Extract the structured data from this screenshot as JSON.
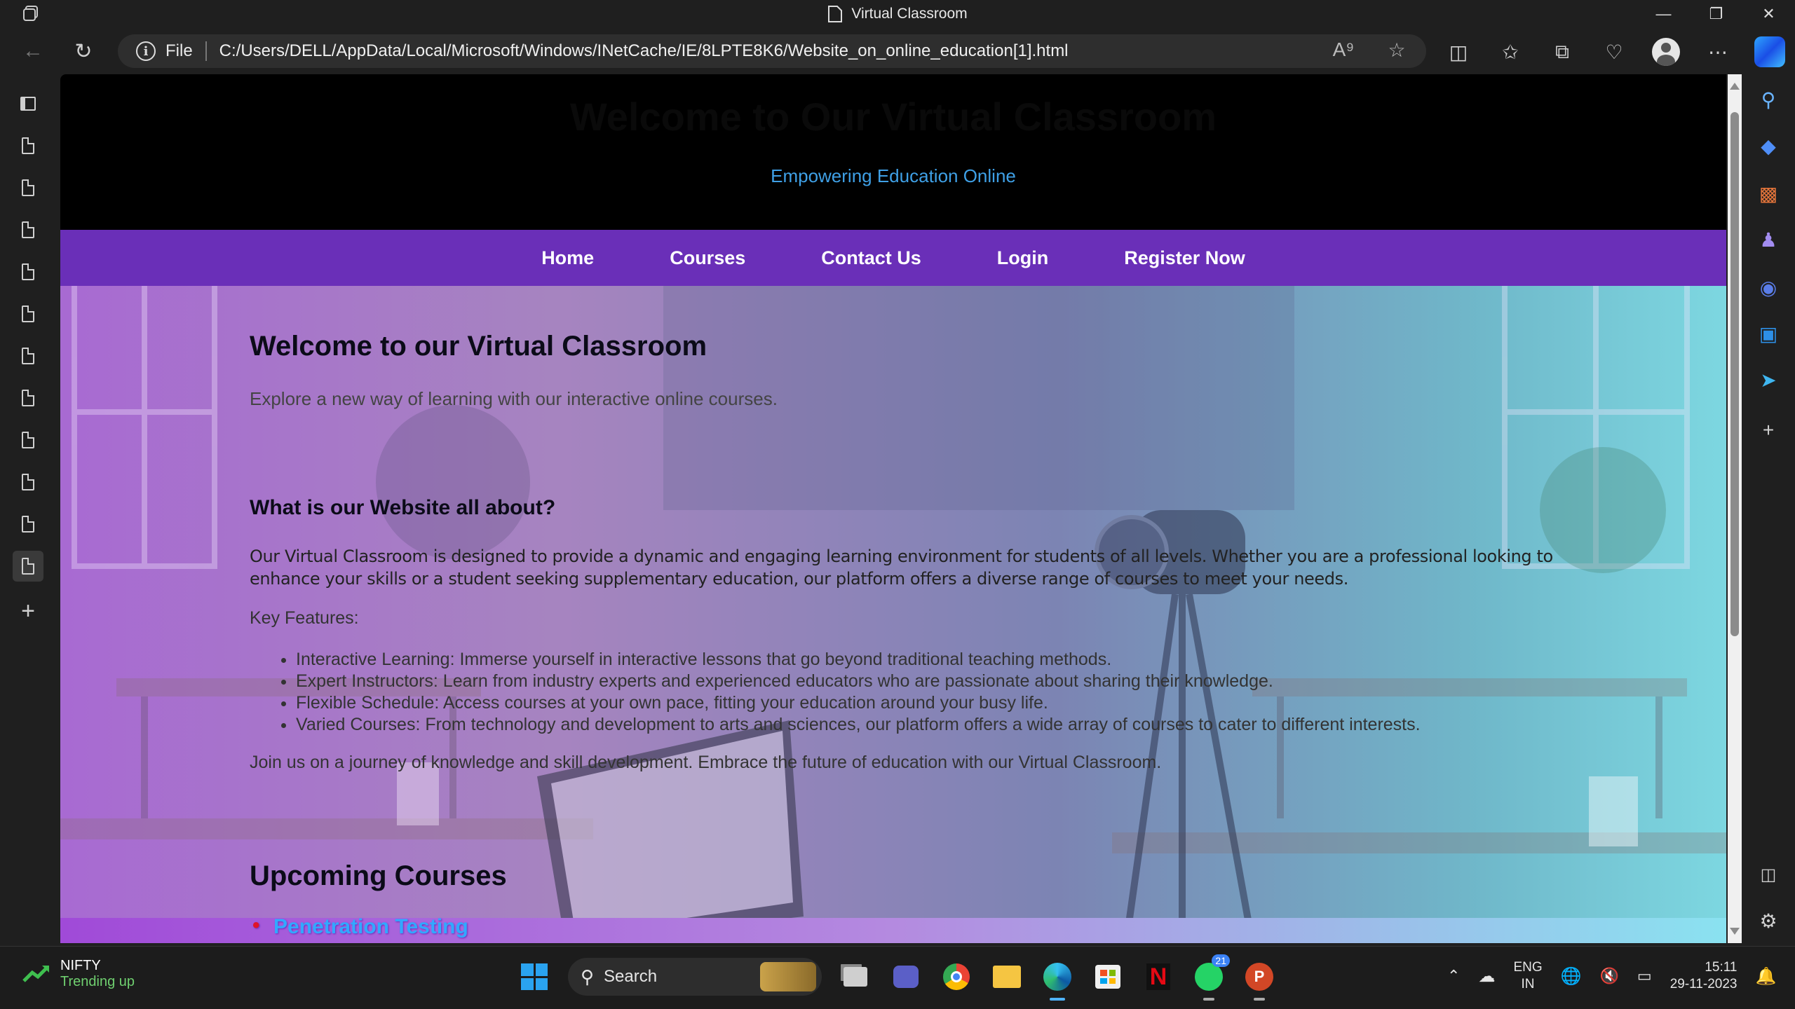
{
  "window": {
    "title": "Virtual Classroom"
  },
  "address_bar": {
    "scheme_label": "File",
    "url": "C:/Users/DELL/AppData/Local/Microsoft/Windows/INetCache/IE/8LPTE8K6/Website_on_online_education[1].html"
  },
  "site": {
    "header_title": "Welcome to Our Virtual Classroom",
    "tagline": "Empowering Education Online",
    "nav": [
      "Home",
      "Courses",
      "Contact Us",
      "Login",
      "Register Now"
    ],
    "welcome_heading": "Welcome to our Virtual Classroom",
    "welcome_text": "Explore a new way of learning with our interactive online courses.",
    "about_heading": "What is our Website all about?",
    "about_text": "Our Virtual Classroom is designed to provide a dynamic and engaging learning environment for students of all levels. Whether you are a professional looking to enhance your skills or a student seeking supplementary education, our platform offers a diverse range of courses to meet your needs.",
    "features_label": "Key Features:",
    "features": [
      "Interactive Learning: Immerse yourself in interactive lessons that go beyond traditional teaching methods.",
      "Expert Instructors: Learn from industry experts and experienced educators who are passionate about sharing their knowledge.",
      "Flexible Schedule: Access courses at your own pace, fitting your education around your busy life.",
      "Varied Courses: From technology and development to arts and sciences, our platform offers a wide array of courses to cater to different interests."
    ],
    "join_text": "Join us on a journey of knowledge and skill development. Embrace the future of education with our Virtual Classroom.",
    "upcoming_heading": "Upcoming Courses",
    "upcoming_courses": [
      "Penetration Testing"
    ]
  },
  "taskbar": {
    "ticker_name": "NIFTY",
    "ticker_status": "Trending up",
    "search_label": "Search",
    "whatsapp_badge": "21",
    "lang_line1": "ENG",
    "lang_line2": "IN",
    "time": "15:11",
    "date": "29-11-2023"
  },
  "colors": {
    "nav_bg": "#6a2fb8",
    "tagline": "#3fa0e6",
    "course_link": "#32a8ff"
  }
}
